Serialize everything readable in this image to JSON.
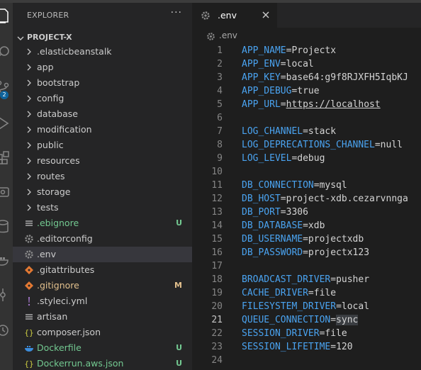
{
  "explorer": {
    "title": "EXPLORER",
    "more": "···",
    "project": "PROJECT-X",
    "items": [
      {
        "label": ".elasticbeanstalk",
        "kind": "folder",
        "status": "",
        "color": ""
      },
      {
        "label": "app",
        "kind": "folder",
        "status": "",
        "color": ""
      },
      {
        "label": "bootstrap",
        "kind": "folder",
        "status": "",
        "color": ""
      },
      {
        "label": "config",
        "kind": "folder",
        "status": "",
        "color": ""
      },
      {
        "label": "database",
        "kind": "folder",
        "status": "",
        "color": ""
      },
      {
        "label": "modification",
        "kind": "folder",
        "status": "",
        "color": ""
      },
      {
        "label": "public",
        "kind": "folder",
        "status": "",
        "color": ""
      },
      {
        "label": "resources",
        "kind": "folder",
        "status": "",
        "color": ""
      },
      {
        "label": "routes",
        "kind": "folder",
        "status": "",
        "color": ""
      },
      {
        "label": "storage",
        "kind": "folder",
        "status": "",
        "color": ""
      },
      {
        "label": "tests",
        "kind": "folder",
        "status": "",
        "color": ""
      },
      {
        "label": ".ebignore",
        "kind": "lines",
        "status": "U",
        "color": "green"
      },
      {
        "label": ".editorconfig",
        "kind": "gear",
        "status": "",
        "color": ""
      },
      {
        "label": ".env",
        "kind": "gear",
        "status": "",
        "color": "",
        "selected": true
      },
      {
        "label": ".gitattributes",
        "kind": "git",
        "status": "",
        "color": ""
      },
      {
        "label": ".gitignore",
        "kind": "git",
        "status": "M",
        "color": "yellow"
      },
      {
        "label": ".styleci.yml",
        "kind": "yml",
        "status": "",
        "color": ""
      },
      {
        "label": "artisan",
        "kind": "lines",
        "status": "",
        "color": ""
      },
      {
        "label": "composer.json",
        "kind": "json",
        "status": "",
        "color": ""
      },
      {
        "label": "Dockerfile",
        "kind": "docker",
        "status": "U",
        "color": "green"
      },
      {
        "label": "Dockerrun.aws.json",
        "kind": "json",
        "status": "U",
        "color": "green"
      }
    ]
  },
  "activity": {
    "badge": "2"
  },
  "editor": {
    "tab_name": ".env",
    "breadcrumb": ".env",
    "active_line": 21,
    "lines": [
      {
        "n": "1",
        "key": "APP_NAME",
        "value": "Projectx"
      },
      {
        "n": "2",
        "key": "APP_ENV",
        "value": "local"
      },
      {
        "n": "3",
        "key": "APP_KEY",
        "value": "base64:g9f8RJXFH5IqbKJ"
      },
      {
        "n": "4",
        "key": "APP_DEBUG",
        "value": "true"
      },
      {
        "n": "5",
        "key": "APP_URL",
        "value": "https://localhost",
        "url": true
      },
      {
        "n": "6",
        "key": "",
        "value": ""
      },
      {
        "n": "7",
        "key": "LOG_CHANNEL",
        "value": "stack"
      },
      {
        "n": "8",
        "key": "LOG_DEPRECATIONS_CHANNEL",
        "value": "null"
      },
      {
        "n": "9",
        "key": "LOG_LEVEL",
        "value": "debug"
      },
      {
        "n": "10",
        "key": "",
        "value": ""
      },
      {
        "n": "11",
        "key": "DB_CONNECTION",
        "value": "mysql"
      },
      {
        "n": "12",
        "key": "DB_HOST",
        "value": "project-xdb.cezarvnnga"
      },
      {
        "n": "13",
        "key": "DB_PORT",
        "value": "3306"
      },
      {
        "n": "14",
        "key": "DB_DATABASE",
        "value": "xdb"
      },
      {
        "n": "15",
        "key": "DB_USERNAME",
        "value": "projectxdb"
      },
      {
        "n": "16",
        "key": "DB_PASSWORD",
        "value": "projectx123"
      },
      {
        "n": "17",
        "key": "",
        "value": ""
      },
      {
        "n": "18",
        "key": "BROADCAST_DRIVER",
        "value": "pusher"
      },
      {
        "n": "19",
        "key": "CACHE_DRIVER",
        "value": "file"
      },
      {
        "n": "20",
        "key": "FILESYSTEM_DRIVER",
        "value": "local"
      },
      {
        "n": "21",
        "key": "QUEUE_CONNECTION",
        "value": "sync",
        "highlight": true
      },
      {
        "n": "22",
        "key": "SESSION_DRIVER",
        "value": "file"
      },
      {
        "n": "23",
        "key": "SESSION_LIFETIME",
        "value": "120"
      },
      {
        "n": "24",
        "key": "",
        "value": ""
      }
    ]
  },
  "colors": {
    "key": "#4aa3f0",
    "untracked": "#73c991",
    "modified": "#e2c08d",
    "json_icon": "#cbcb41",
    "yml_icon": "#a074c4",
    "git_icon": "#e37933",
    "docker_icon": "#3c8ddc"
  }
}
